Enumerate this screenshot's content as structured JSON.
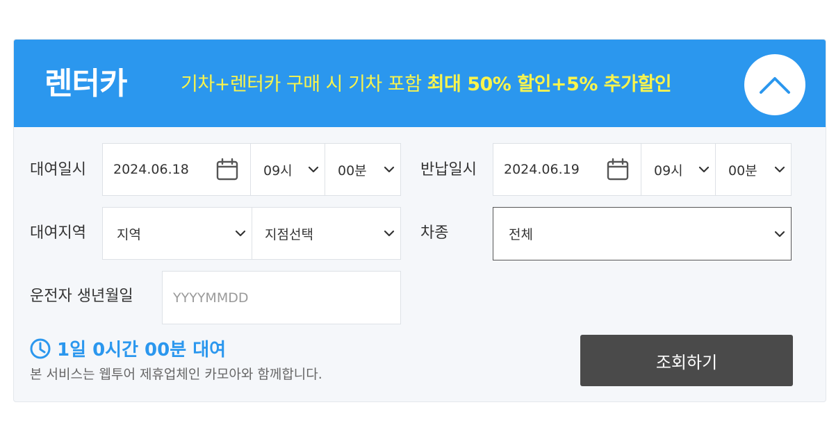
{
  "header": {
    "title": "렌터카",
    "promo_normal": "기차+렌터카 구매 시 기차 포함",
    "promo_strong": "최대 50% 할인+5% 추가할인"
  },
  "rental_datetime": {
    "label": "대여일시",
    "date": "2024.06.18",
    "hour": "09시",
    "minute": "00분"
  },
  "return_datetime": {
    "label": "반납일시",
    "date": "2024.06.19",
    "hour": "09시",
    "minute": "00분"
  },
  "rental_area": {
    "label": "대여지역",
    "region": "지역",
    "branch": "지점선택"
  },
  "car_type": {
    "label": "차종",
    "value": "전체"
  },
  "driver_birth": {
    "label": "운전자 생년월일",
    "placeholder": "YYYYMMDD"
  },
  "duration": "1일 0시간 00분 대여",
  "notice": "본 서비스는 웹투어 제휴업체인 카모아와 함께합니다.",
  "search_button": "조회하기",
  "colors": {
    "header_bg": "#2b97ee",
    "promo_text": "#f9f44d",
    "accent": "#2b97ee",
    "button_bg": "#4a4a4a"
  }
}
